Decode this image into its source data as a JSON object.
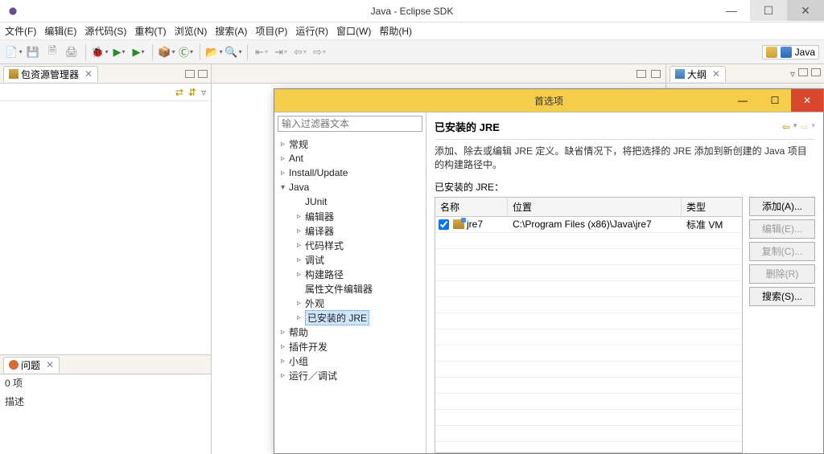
{
  "window": {
    "title": "Java  -  Eclipse SDK"
  },
  "menu": [
    "文件(F)",
    "编辑(E)",
    "源代码(S)",
    "重构(T)",
    "浏览(N)",
    "搜索(A)",
    "项目(P)",
    "运行(R)",
    "窗口(W)",
    "帮助(H)"
  ],
  "perspective": {
    "label": "Java"
  },
  "views": {
    "pkg_explorer": {
      "title": "包资源管理器"
    },
    "problems": {
      "title": "问题",
      "count_line": "0 项",
      "desc_label": "描述"
    },
    "outline": {
      "title": "大纲"
    }
  },
  "preferences": {
    "dialog_title": "首选项",
    "filter_placeholder": "输入过滤器文本",
    "tree": {
      "general": "常规",
      "ant": "Ant",
      "install": "Install/Update",
      "java": "Java",
      "java_children": {
        "junit": "JUnit",
        "editor": "编辑器",
        "compiler": "编译器",
        "codestyle": "代码样式",
        "debug": "调试",
        "buildpath": "构建路径",
        "propfile": "属性文件编辑器",
        "appearance": "外观",
        "installed_jre": "已安装的 JRE"
      },
      "help": "帮助",
      "plugin_dev": "插件开发",
      "team": "小组",
      "run_debug": "运行／调试"
    },
    "page": {
      "title": "已安装的 JRE",
      "desc": "添加、除去或编辑 JRE 定义。缺省情况下，将把选择的 JRE 添加到新创建的 Java 项目的构建路径中。",
      "list_label": "已安装的 JRE：",
      "columns": {
        "name": "名称",
        "location": "位置",
        "type": "类型"
      },
      "rows": [
        {
          "name": "jre7",
          "location": "C:\\Program Files (x86)\\Java\\jre7",
          "type": "标准 VM"
        }
      ],
      "buttons": {
        "add": "添加(A)...",
        "edit": "编辑(E)...",
        "copy": "复制(C)...",
        "remove": "删除(R)",
        "search": "搜索(S)..."
      }
    }
  }
}
